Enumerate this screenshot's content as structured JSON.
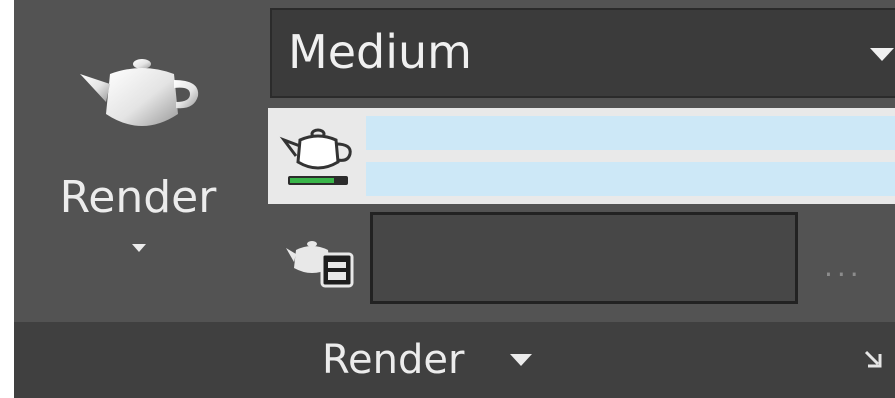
{
  "render_button": {
    "label": "Render",
    "icon": "teapot-icon"
  },
  "render_quality": {
    "selected": "Medium",
    "icon": "chevron-down-icon"
  },
  "render_progress": {
    "icon": "teapot-progress-icon",
    "top_bar_progress": 0,
    "bottom_bar_progress": 0
  },
  "render_queue": {
    "icon": "teapot-queue-icon",
    "value": "",
    "browse_label": "..."
  },
  "panel": {
    "title": "Render",
    "icon": "dialog-launcher-icon"
  },
  "colors": {
    "panel_bg": "#535353",
    "footer_bg": "#404040",
    "progress_bg": "#cde8f7",
    "progress_accent": "#39b54a"
  }
}
